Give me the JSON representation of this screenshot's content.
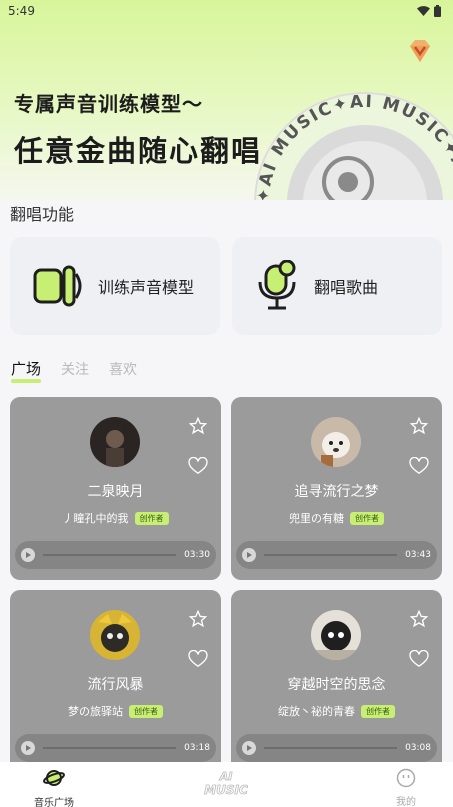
{
  "status": {
    "time": "5:49"
  },
  "banner": {
    "line1": "专属声音训练模型〜",
    "line2": "任意金曲随心翻唱",
    "ring_text": "✦AI MUSIC✦AI MUSIC✦AI MUSIC✦"
  },
  "section": {
    "title": "翻唱功能"
  },
  "features": [
    {
      "label": "训练声音模型",
      "icon": "speaker-icon"
    },
    {
      "label": "翻唱歌曲",
      "icon": "microphone-icon"
    }
  ],
  "tabs": [
    {
      "label": "广场",
      "active": true
    },
    {
      "label": "关注",
      "active": false
    },
    {
      "label": "喜欢",
      "active": false
    }
  ],
  "songs": [
    {
      "title": "二泉映月",
      "author": "丿瞳孔中的我",
      "badge": "创作者",
      "duration": "03:30"
    },
    {
      "title": "追寻流行之梦",
      "author": "兜里の有糖",
      "badge": "创作者",
      "duration": "03:43"
    },
    {
      "title": "流行风暴",
      "author": "梦の旅驿站",
      "badge": "创作者",
      "duration": "03:18"
    },
    {
      "title": "穿越时空的思念",
      "author": "绽放丶祕的青春",
      "badge": "创作者",
      "duration": "03:08"
    }
  ],
  "nav": {
    "left": "音乐广场",
    "center_top": "AI",
    "center_bottom": "MUSIC",
    "right": "我的"
  },
  "colors": {
    "accent": "#c6ef73",
    "card": "#9b9b9b"
  }
}
